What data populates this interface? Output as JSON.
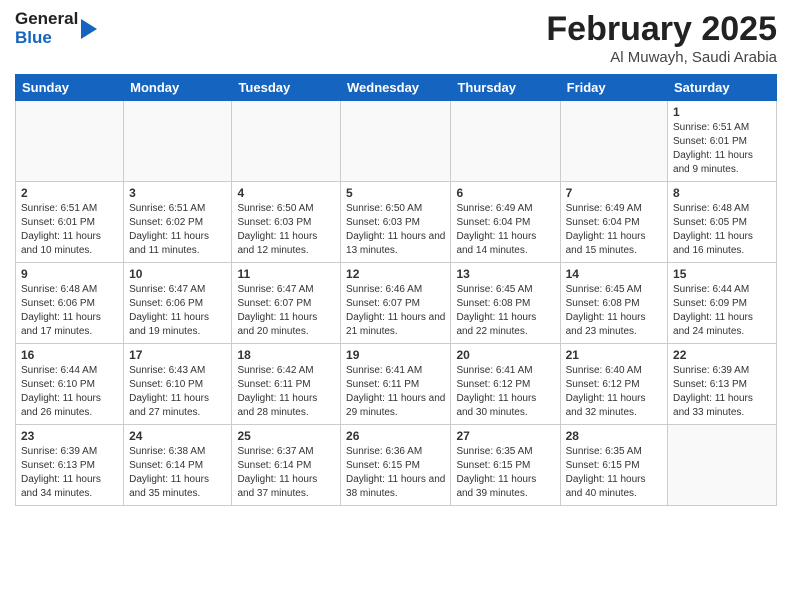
{
  "logo": {
    "line1": "General",
    "line2": "Blue"
  },
  "title": "February 2025",
  "subtitle": "Al Muwayh, Saudi Arabia",
  "days_of_week": [
    "Sunday",
    "Monday",
    "Tuesday",
    "Wednesday",
    "Thursday",
    "Friday",
    "Saturday"
  ],
  "weeks": [
    [
      {
        "day": "",
        "info": ""
      },
      {
        "day": "",
        "info": ""
      },
      {
        "day": "",
        "info": ""
      },
      {
        "day": "",
        "info": ""
      },
      {
        "day": "",
        "info": ""
      },
      {
        "day": "",
        "info": ""
      },
      {
        "day": "1",
        "info": "Sunrise: 6:51 AM\nSunset: 6:01 PM\nDaylight: 11 hours and 9 minutes."
      }
    ],
    [
      {
        "day": "2",
        "info": "Sunrise: 6:51 AM\nSunset: 6:01 PM\nDaylight: 11 hours and 10 minutes."
      },
      {
        "day": "3",
        "info": "Sunrise: 6:51 AM\nSunset: 6:02 PM\nDaylight: 11 hours and 11 minutes."
      },
      {
        "day": "4",
        "info": "Sunrise: 6:50 AM\nSunset: 6:03 PM\nDaylight: 11 hours and 12 minutes."
      },
      {
        "day": "5",
        "info": "Sunrise: 6:50 AM\nSunset: 6:03 PM\nDaylight: 11 hours and 13 minutes."
      },
      {
        "day": "6",
        "info": "Sunrise: 6:49 AM\nSunset: 6:04 PM\nDaylight: 11 hours and 14 minutes."
      },
      {
        "day": "7",
        "info": "Sunrise: 6:49 AM\nSunset: 6:04 PM\nDaylight: 11 hours and 15 minutes."
      },
      {
        "day": "8",
        "info": "Sunrise: 6:48 AM\nSunset: 6:05 PM\nDaylight: 11 hours and 16 minutes."
      }
    ],
    [
      {
        "day": "9",
        "info": "Sunrise: 6:48 AM\nSunset: 6:06 PM\nDaylight: 11 hours and 17 minutes."
      },
      {
        "day": "10",
        "info": "Sunrise: 6:47 AM\nSunset: 6:06 PM\nDaylight: 11 hours and 19 minutes."
      },
      {
        "day": "11",
        "info": "Sunrise: 6:47 AM\nSunset: 6:07 PM\nDaylight: 11 hours and 20 minutes."
      },
      {
        "day": "12",
        "info": "Sunrise: 6:46 AM\nSunset: 6:07 PM\nDaylight: 11 hours and 21 minutes."
      },
      {
        "day": "13",
        "info": "Sunrise: 6:45 AM\nSunset: 6:08 PM\nDaylight: 11 hours and 22 minutes."
      },
      {
        "day": "14",
        "info": "Sunrise: 6:45 AM\nSunset: 6:08 PM\nDaylight: 11 hours and 23 minutes."
      },
      {
        "day": "15",
        "info": "Sunrise: 6:44 AM\nSunset: 6:09 PM\nDaylight: 11 hours and 24 minutes."
      }
    ],
    [
      {
        "day": "16",
        "info": "Sunrise: 6:44 AM\nSunset: 6:10 PM\nDaylight: 11 hours and 26 minutes."
      },
      {
        "day": "17",
        "info": "Sunrise: 6:43 AM\nSunset: 6:10 PM\nDaylight: 11 hours and 27 minutes."
      },
      {
        "day": "18",
        "info": "Sunrise: 6:42 AM\nSunset: 6:11 PM\nDaylight: 11 hours and 28 minutes."
      },
      {
        "day": "19",
        "info": "Sunrise: 6:41 AM\nSunset: 6:11 PM\nDaylight: 11 hours and 29 minutes."
      },
      {
        "day": "20",
        "info": "Sunrise: 6:41 AM\nSunset: 6:12 PM\nDaylight: 11 hours and 30 minutes."
      },
      {
        "day": "21",
        "info": "Sunrise: 6:40 AM\nSunset: 6:12 PM\nDaylight: 11 hours and 32 minutes."
      },
      {
        "day": "22",
        "info": "Sunrise: 6:39 AM\nSunset: 6:13 PM\nDaylight: 11 hours and 33 minutes."
      }
    ],
    [
      {
        "day": "23",
        "info": "Sunrise: 6:39 AM\nSunset: 6:13 PM\nDaylight: 11 hours and 34 minutes."
      },
      {
        "day": "24",
        "info": "Sunrise: 6:38 AM\nSunset: 6:14 PM\nDaylight: 11 hours and 35 minutes."
      },
      {
        "day": "25",
        "info": "Sunrise: 6:37 AM\nSunset: 6:14 PM\nDaylight: 11 hours and 37 minutes."
      },
      {
        "day": "26",
        "info": "Sunrise: 6:36 AM\nSunset: 6:15 PM\nDaylight: 11 hours and 38 minutes."
      },
      {
        "day": "27",
        "info": "Sunrise: 6:35 AM\nSunset: 6:15 PM\nDaylight: 11 hours and 39 minutes."
      },
      {
        "day": "28",
        "info": "Sunrise: 6:35 AM\nSunset: 6:15 PM\nDaylight: 11 hours and 40 minutes."
      },
      {
        "day": "",
        "info": ""
      }
    ]
  ]
}
